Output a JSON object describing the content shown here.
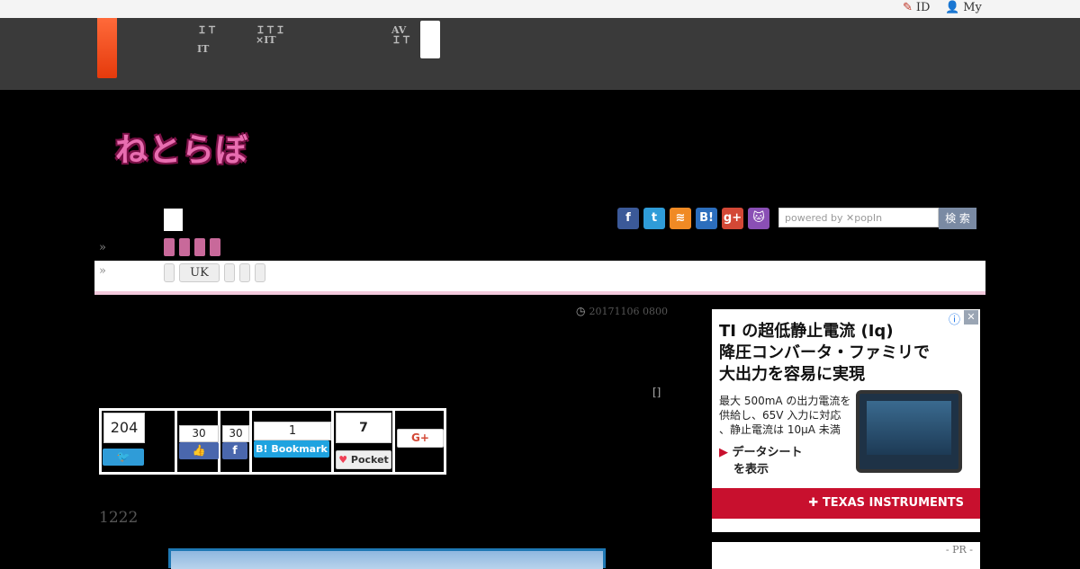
{
  "topbar": {
    "id_label": "ID",
    "my_label": "My"
  },
  "gnav": {
    "items": [
      {
        "line1": "ＩＴ",
        "line2": "IT"
      },
      {
        "line1": "ＩＴＩ",
        "line2": "×IT"
      },
      {
        "line1": "AV",
        "line2": "ＩＴ"
      }
    ]
  },
  "site": {
    "logo_text": "ねとらぼ"
  },
  "subnav": {
    "uk_tag": "UK",
    "arrow": "»"
  },
  "social": {
    "icons": [
      {
        "name": "facebook-icon",
        "glyph": "f",
        "color": "#3b5998"
      },
      {
        "name": "twitter-icon",
        "glyph": "t",
        "color": "#2f9cd8"
      },
      {
        "name": "rss-icon",
        "glyph": "≋",
        "color": "#f08a24"
      },
      {
        "name": "hatena-icon",
        "glyph": "B!",
        "color": "#2c6ebd"
      },
      {
        "name": "googleplus-icon",
        "glyph": "g+",
        "color": "#d34836"
      },
      {
        "name": "cat-icon",
        "glyph": "🐱",
        "color": "#8a4fb5"
      }
    ]
  },
  "search": {
    "placeholder": "powered by ✕popIn",
    "button": "検 索"
  },
  "article": {
    "date": "20171106 0800",
    "bracket": "[]",
    "views": "1222"
  },
  "share": {
    "twitter_count": "204",
    "like_count": "30",
    "fb_count": "30",
    "hatena_count": "1",
    "hatena_label": "B! Bookmark",
    "pocket_count": "7",
    "pocket_label": "Pocket",
    "gplus_label": "G+"
  },
  "ad": {
    "headline1": "TI の超低静止電流 (Iq)",
    "headline2": "降圧コンバータ・ファミリで",
    "headline3": "大出力を容易に実現",
    "body1": "最大 500mA の出力電流を",
    "body2": "供給し、65V",
    "body3": "入力に対応",
    "body4": "、静止電流は 10μA 未満",
    "cta1": "データシート",
    "cta2": "を表示",
    "brand": "TEXAS INSTRUMENTS",
    "info_icon": "ⓘ",
    "close_icon": "✕"
  },
  "pr": {
    "label": "- PR -"
  },
  "colors": {
    "accent": "#e53a0c",
    "pink": "#c8699a",
    "ti_red": "#c8102e"
  }
}
